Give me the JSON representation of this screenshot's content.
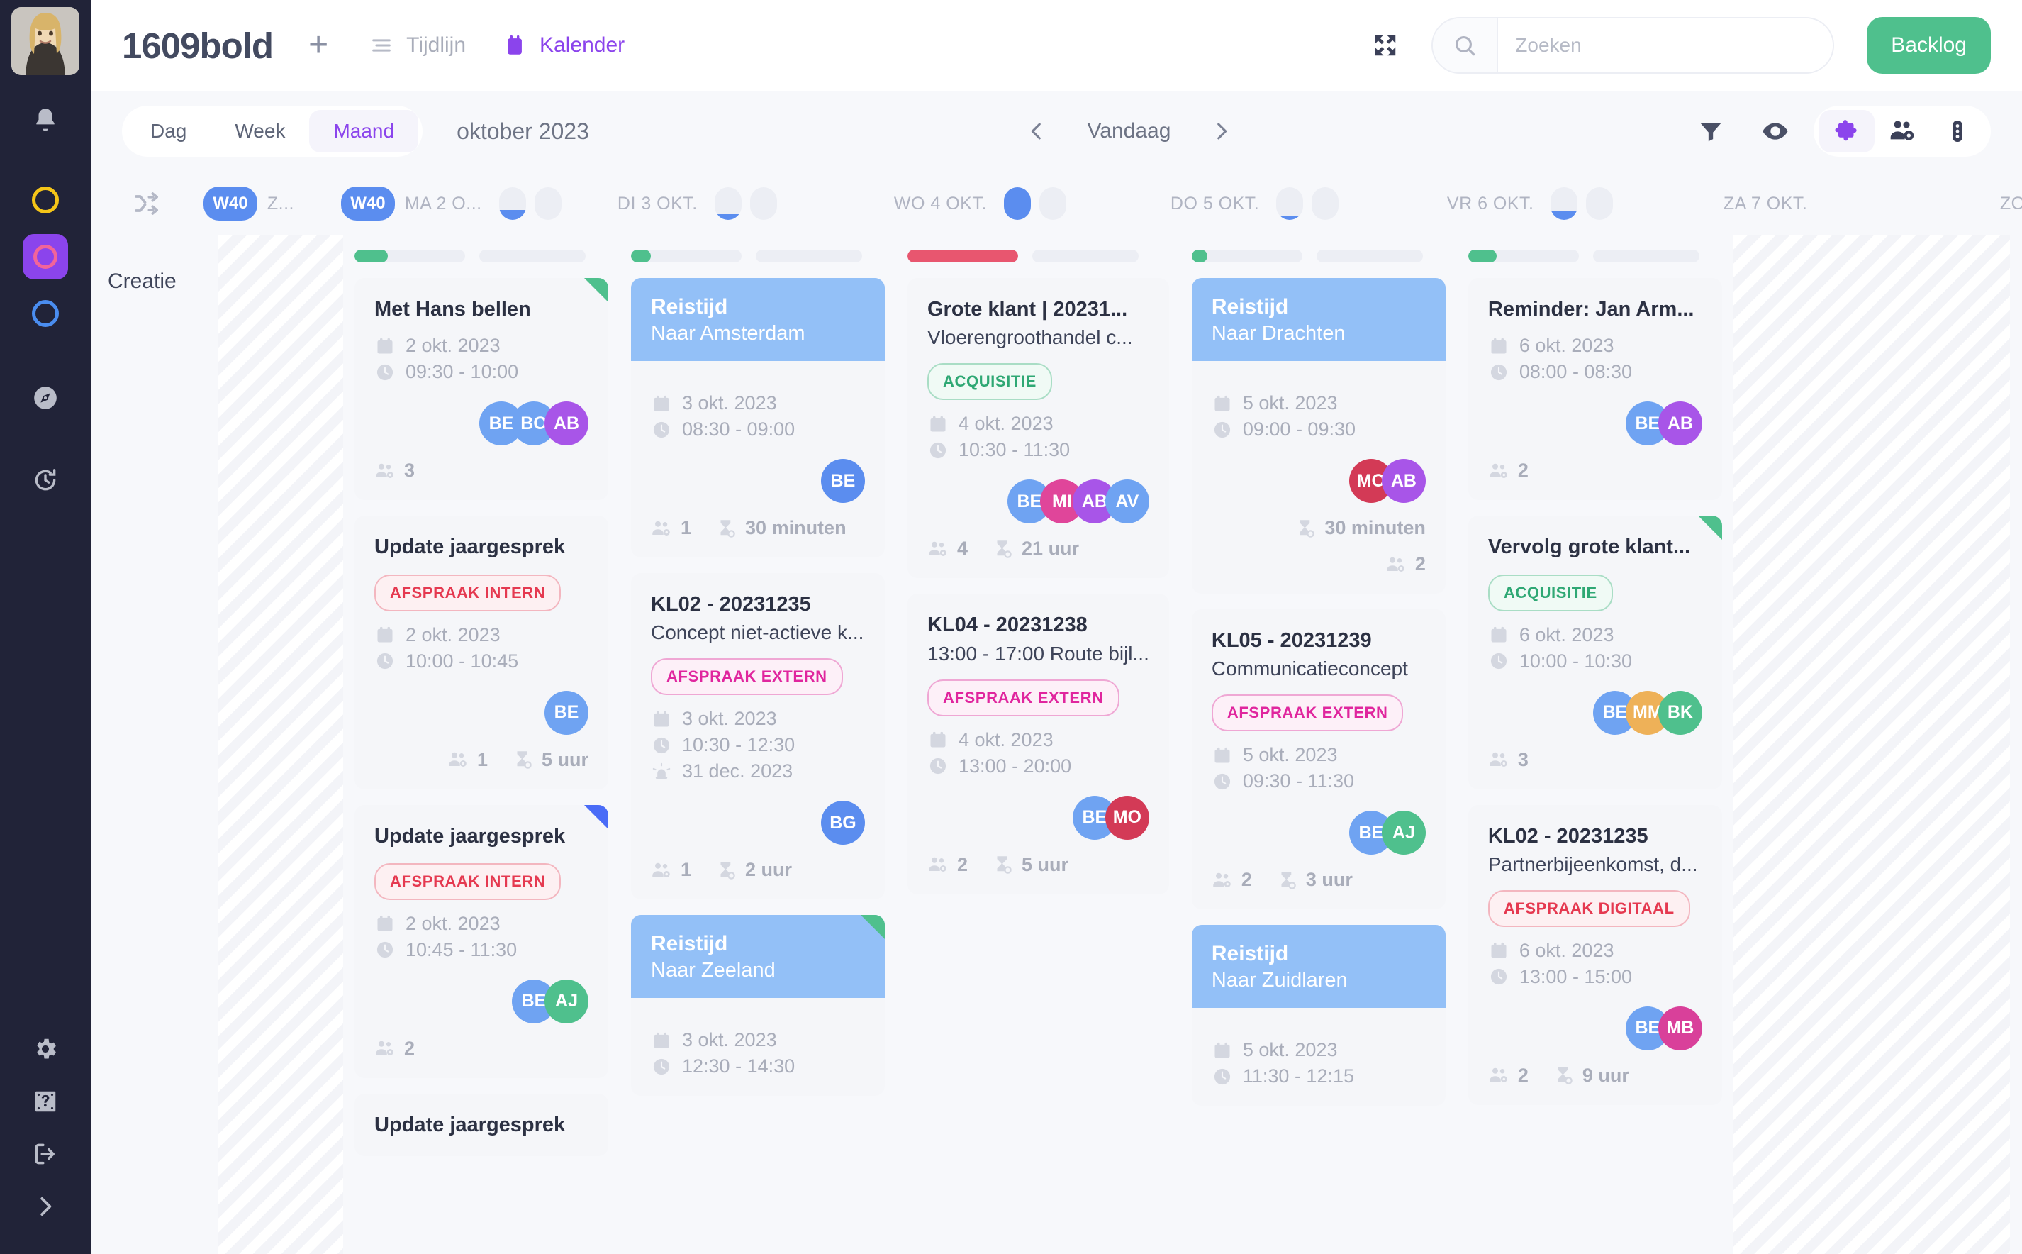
{
  "brand": "1609bold",
  "topnav": {
    "add_label": "+",
    "items": [
      {
        "label": "Tijdlijn",
        "icon": "timeline-icon",
        "active": false
      },
      {
        "label": "Kalender",
        "icon": "calendar-icon",
        "active": true
      }
    ]
  },
  "search": {
    "placeholder": "Zoeken",
    "value": "",
    "icon": "search-icon"
  },
  "backlog_label": "Backlog",
  "expand_icon": "expand-icon",
  "toolbar": {
    "views": [
      {
        "label": "Dag",
        "active": false
      },
      {
        "label": "Week",
        "active": false
      },
      {
        "label": "Maand",
        "active": true
      }
    ],
    "period": "oktober 2023",
    "prev_icon": "chevron-left-icon",
    "next_icon": "chevron-right-icon",
    "today_label": "Vandaag",
    "icons": [
      {
        "name": "filter-icon",
        "active": false
      },
      {
        "name": "eye-icon",
        "active": false
      }
    ],
    "pillgroup": [
      {
        "name": "puzzle-icon",
        "active": true
      },
      {
        "name": "people-gear-icon",
        "active": false
      },
      {
        "name": "traffic-light-icon",
        "active": false
      }
    ]
  },
  "sidebar": {
    "avatar": "user-avatar",
    "items": [
      {
        "name": "bell-icon",
        "type": "icon"
      },
      {
        "name": "ring-yellow",
        "type": "ring",
        "color": "#f5c518",
        "active": false
      },
      {
        "name": "ring-pink",
        "type": "ring",
        "color": "#f2649a",
        "active": true
      },
      {
        "name": "ring-blue",
        "type": "ring",
        "color": "#4a8df0",
        "active": false
      },
      {
        "name": "compass-icon",
        "type": "icon"
      },
      {
        "name": "timer-icon",
        "type": "icon"
      }
    ],
    "bottom_items": [
      {
        "name": "gear-icon"
      },
      {
        "name": "help-icon"
      },
      {
        "name": "logout-icon"
      },
      {
        "name": "expand-rail-icon"
      }
    ]
  },
  "dayheader": {
    "shuffle_icon": "shuffle-icon",
    "columns": [
      {
        "week": "W40",
        "label": "Z...",
        "dots": []
      },
      {
        "week": "W40",
        "label": "MA 2 O...",
        "dots": [
          {
            "fill": 0.3
          },
          {
            "fill": 0
          }
        ]
      },
      {
        "week": "",
        "label": "DI 3 OKT.",
        "dots": [
          {
            "fill": 0.18
          },
          {
            "fill": 0
          }
        ]
      },
      {
        "week": "",
        "label": "WO 4 OKT.",
        "dots": [
          {
            "fill": 1.0
          },
          {
            "fill": 0
          }
        ]
      },
      {
        "week": "",
        "label": "DO 5 OKT.",
        "dots": [
          {
            "fill": 0.14
          },
          {
            "fill": 0
          }
        ]
      },
      {
        "week": "",
        "label": "VR 6 OKT.",
        "dots": [
          {
            "fill": 0.26
          },
          {
            "fill": 0
          }
        ]
      },
      {
        "week": "",
        "label": "ZA 7 OKT.",
        "dots": []
      },
      {
        "week": "",
        "label": "ZO",
        "dots": []
      }
    ]
  },
  "row_label": "Creatie",
  "colors": {
    "accent": "#8b44ec",
    "green": "#4fc08d",
    "red": "#e8566f",
    "blue": "#5b8def",
    "travel_blue": "#93c0f7",
    "tag_red": "#e53950",
    "tag_pink": "#e0269e",
    "tag_green": "#2fa874"
  },
  "columns": [
    {
      "id": "col-sunday",
      "hatched": true,
      "capbars": [],
      "cards": []
    },
    {
      "id": "col-ma-2-okt",
      "hatched": false,
      "capbars": [
        {
          "fill": 0.3,
          "color": "#4fc08d"
        },
        {
          "fill": 0,
          "color": "#4fc08d"
        }
      ],
      "cards": [
        {
          "type": "task",
          "corner": "#4fc08d",
          "title": "Met Hans bellen",
          "subtitle": "",
          "tag": null,
          "date": "2 okt. 2023",
          "time": "09:30 - 10:00",
          "deadline": null,
          "avatars": [
            {
              "initials": "BE",
              "color": "#6fa3f2"
            },
            {
              "initials": "BO",
              "color": "#6fa3f2"
            },
            {
              "initials": "AB",
              "color": "#a855e8"
            }
          ],
          "people_count": "3",
          "duration": null,
          "footer_layout": "split"
        },
        {
          "type": "task",
          "corner": null,
          "title": "Update jaargesprek",
          "subtitle": "",
          "tag": {
            "label": "AFSPRAAK INTERN",
            "style": "red"
          },
          "date": "2 okt. 2023",
          "time": "10:00 - 10:45",
          "deadline": null,
          "avatars": [
            {
              "initials": "BE",
              "color": "#6fa3f2"
            }
          ],
          "people_count": "1",
          "duration": "5 uur",
          "footer_layout": "right"
        },
        {
          "type": "task",
          "corner": "#4a6cf7",
          "title": "Update jaargesprek",
          "subtitle": "",
          "tag": {
            "label": "AFSPRAAK INTERN",
            "style": "red"
          },
          "date": "2 okt. 2023",
          "time": "10:45 - 11:30",
          "deadline": null,
          "avatars": [
            {
              "initials": "BE",
              "color": "#6fa3f2"
            },
            {
              "initials": "AJ",
              "color": "#4fc08d"
            }
          ],
          "people_count": "2",
          "duration": null,
          "footer_layout": "split"
        },
        {
          "type": "task",
          "corner": null,
          "title": "Update jaargesprek",
          "subtitle": "",
          "tag": null,
          "date": "",
          "time": "",
          "deadline": null,
          "avatars": [],
          "people_count": null,
          "duration": null,
          "footer_layout": "none"
        }
      ]
    },
    {
      "id": "col-di-3-okt",
      "hatched": false,
      "capbars": [
        {
          "fill": 0.18,
          "color": "#4fc08d"
        },
        {
          "fill": 0,
          "color": "#4fc08d"
        }
      ],
      "cards": [
        {
          "type": "travel",
          "corner": null,
          "title": "Reistijd",
          "subtitle": "Naar Amsterdam",
          "tag": null,
          "date": "3 okt. 2023",
          "time": "08:30 - 09:00",
          "deadline": null,
          "avatars": [
            {
              "initials": "BE",
              "color": "#5b8def"
            }
          ],
          "people_count": "1",
          "duration": "30 minuten",
          "footer_layout": "split"
        },
        {
          "type": "task",
          "corner": null,
          "title": "KL02 - 20231235",
          "subtitle": "Concept niet-actieve k...",
          "tag": {
            "label": "AFSPRAAK EXTERN",
            "style": "pink"
          },
          "date": "3 okt. 2023",
          "time": "10:30 - 12:30",
          "deadline": "31 dec. 2023",
          "avatars": [
            {
              "initials": "BG",
              "color": "#5b8def"
            }
          ],
          "people_count": "1",
          "duration": "2 uur",
          "footer_layout": "split"
        },
        {
          "type": "travel",
          "corner": "#4fc08d",
          "title": "Reistijd",
          "subtitle": "Naar Zeeland",
          "tag": null,
          "date": "3 okt. 2023",
          "time": "12:30 - 14:30",
          "deadline": null,
          "avatars": [],
          "people_count": null,
          "duration": null,
          "footer_layout": "none"
        }
      ]
    },
    {
      "id": "col-wo-4-okt",
      "hatched": false,
      "capbars": [
        {
          "fill": 1.0,
          "color": "#e8566f"
        },
        {
          "fill": 0,
          "color": "#e8566f"
        }
      ],
      "cards": [
        {
          "type": "task",
          "corner": null,
          "title": "Grote klant | 20231...",
          "subtitle": "Vloerengroothandel c...",
          "tag": {
            "label": "ACQUISITIE",
            "style": "green"
          },
          "date": "4 okt. 2023",
          "time": "10:30 - 11:30",
          "deadline": null,
          "avatars": [
            {
              "initials": "BE",
              "color": "#6fa3f2"
            },
            {
              "initials": "MI",
              "color": "#e0459a"
            },
            {
              "initials": "AB",
              "color": "#a855e8"
            },
            {
              "initials": "AV",
              "color": "#6fa3f2"
            }
          ],
          "people_count": "4",
          "duration": "21 uur",
          "footer_layout": "split"
        },
        {
          "type": "task",
          "corner": null,
          "title": "KL04 - 20231238",
          "subtitle": "13:00 - 17:00 Route bijl...",
          "tag": {
            "label": "AFSPRAAK EXTERN",
            "style": "pink"
          },
          "date": "4 okt. 2023",
          "time": "13:00 - 20:00",
          "deadline": null,
          "avatars": [
            {
              "initials": "BE",
              "color": "#6fa3f2"
            },
            {
              "initials": "MO",
              "color": "#d33a56"
            }
          ],
          "people_count": "2",
          "duration": "5 uur",
          "footer_layout": "split"
        }
      ]
    },
    {
      "id": "col-do-5-okt",
      "hatched": false,
      "capbars": [
        {
          "fill": 0.14,
          "color": "#4fc08d"
        },
        {
          "fill": 0,
          "color": "#4fc08d"
        }
      ],
      "cards": [
        {
          "type": "travel",
          "corner": null,
          "title": "Reistijd",
          "subtitle": "Naar Drachten",
          "tag": null,
          "date": "5 okt. 2023",
          "time": "09:00 - 09:30",
          "deadline": null,
          "avatars": [
            {
              "initials": "MO",
              "color": "#d33a56"
            },
            {
              "initials": "AB",
              "color": "#a855e8"
            }
          ],
          "people_count": "2",
          "duration": "30 minuten",
          "footer_layout": "stacked"
        },
        {
          "type": "task",
          "corner": null,
          "title": "KL05 - 20231239",
          "subtitle": "Communicatieconcept",
          "tag": {
            "label": "AFSPRAAK EXTERN",
            "style": "pink"
          },
          "date": "5 okt. 2023",
          "time": "09:30 - 11:30",
          "deadline": null,
          "avatars": [
            {
              "initials": "BE",
              "color": "#6fa3f2"
            },
            {
              "initials": "AJ",
              "color": "#4fc08d"
            }
          ],
          "people_count": "2",
          "duration": "3 uur",
          "footer_layout": "split"
        },
        {
          "type": "travel",
          "corner": null,
          "title": "Reistijd",
          "subtitle": "Naar Zuidlaren",
          "tag": null,
          "date": "5 okt. 2023",
          "time": "11:30 - 12:15",
          "deadline": null,
          "avatars": [],
          "people_count": null,
          "duration": null,
          "footer_layout": "none"
        }
      ]
    },
    {
      "id": "col-vr-6-okt",
      "hatched": false,
      "capbars": [
        {
          "fill": 0.26,
          "color": "#4fc08d"
        },
        {
          "fill": 0,
          "color": "#4fc08d"
        }
      ],
      "cards": [
        {
          "type": "task",
          "corner": null,
          "title": "Reminder: Jan Arm...",
          "subtitle": "",
          "tag": null,
          "date": "6 okt. 2023",
          "time": "08:00 - 08:30",
          "deadline": null,
          "avatars": [
            {
              "initials": "BE",
              "color": "#6fa3f2"
            },
            {
              "initials": "AB",
              "color": "#a855e8"
            }
          ],
          "people_count": "2",
          "duration": null,
          "footer_layout": "split"
        },
        {
          "type": "task",
          "corner": "#4fc08d",
          "title": "Vervolg grote klant...",
          "subtitle": "",
          "tag": {
            "label": "ACQUISITIE",
            "style": "green"
          },
          "date": "6 okt. 2023",
          "time": "10:00 - 10:30",
          "deadline": null,
          "avatars": [
            {
              "initials": "BE",
              "color": "#6fa3f2"
            },
            {
              "initials": "MM",
              "color": "#eeb158"
            },
            {
              "initials": "BK",
              "color": "#4fc08d"
            }
          ],
          "people_count": "3",
          "duration": null,
          "footer_layout": "split"
        },
        {
          "type": "task",
          "corner": null,
          "title": "KL02 - 20231235",
          "subtitle": "Partnerbijeenkomst, d...",
          "tag": {
            "label": "AFSPRAAK DIGITAAL",
            "style": "red"
          },
          "date": "6 okt. 2023",
          "time": "13:00 - 15:00",
          "deadline": null,
          "avatars": [
            {
              "initials": "BE",
              "color": "#6fa3f2"
            },
            {
              "initials": "MB",
              "color": "#d9409a"
            }
          ],
          "people_count": "2",
          "duration": "9 uur",
          "footer_layout": "split"
        }
      ]
    },
    {
      "id": "col-za-7-okt",
      "hatched": true,
      "capbars": [],
      "cards": []
    }
  ]
}
